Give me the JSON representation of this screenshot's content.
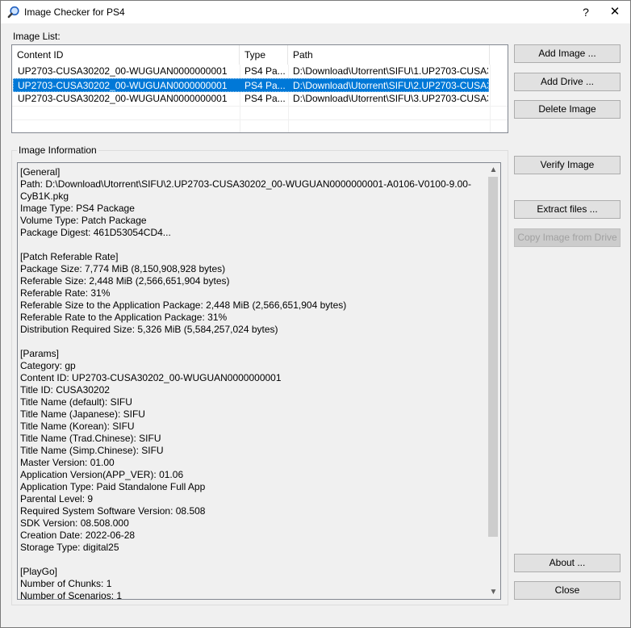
{
  "window": {
    "title": "Image Checker for PS4",
    "help_label": "?",
    "close_label": "✕"
  },
  "image_list": {
    "label": "Image List:",
    "columns": [
      "Content ID",
      "Type",
      "Path"
    ],
    "rows": [
      {
        "content_id": "UP2703-CUSA30202_00-WUGUAN0000000001",
        "type": "PS4 Pa...",
        "path": "D:\\Download\\Utorrent\\SIFU\\1.UP2703-CUSA3...",
        "selected": false
      },
      {
        "content_id": "UP2703-CUSA30202_00-WUGUAN0000000001",
        "type": "PS4 Pa...",
        "path": "D:\\Download\\Utorrent\\SIFU\\2.UP2703-CUSA3...",
        "selected": true
      },
      {
        "content_id": "UP2703-CUSA30202_00-WUGUAN0000000001",
        "type": "PS4 Pa...",
        "path": "D:\\Download\\Utorrent\\SIFU\\3.UP2703-CUSA3...",
        "selected": false
      }
    ]
  },
  "buttons": {
    "add_image": "Add Image ...",
    "add_drive": "Add Drive ...",
    "delete_image": "Delete Image",
    "verify_image": "Verify Image",
    "extract_files": "Extract files ...",
    "copy_image": "Copy Image from Drive",
    "about": "About ...",
    "close": "Close"
  },
  "image_info": {
    "label": "Image Information",
    "text": "[General]\nPath: D:\\Download\\Utorrent\\SIFU\\2.UP2703-CUSA30202_00-WUGUAN0000000001-A0106-V0100-9.00-CyB1K.pkg\nImage Type: PS4 Package\nVolume Type: Patch Package\nPackage Digest: 461D53054CD4...\n\n[Patch Referable Rate]\nPackage Size: 7,774 MiB (8,150,908,928 bytes)\nReferable Size: 2,448 MiB (2,566,651,904 bytes)\nReferable Rate: 31%\nReferable Size to the Application Package: 2,448 MiB (2,566,651,904 bytes)\nReferable Rate to the Application Package: 31%\nDistribution Required Size: 5,326 MiB (5,584,257,024 bytes)\n\n[Params]\nCategory: gp\nContent ID: UP2703-CUSA30202_00-WUGUAN0000000001\nTitle ID: CUSA30202\nTitle Name (default): SIFU\nTitle Name (Japanese): SIFU\nTitle Name (Korean): SIFU\nTitle Name (Trad.Chinese): SIFU\nTitle Name (Simp.Chinese): SIFU\nMaster Version: 01.00\nApplication Version(APP_VER): 01.06\nApplication Type: Paid Standalone Full App\nParental Level: 9\nRequired System Software Version: 08.508\nSDK Version: 08.508.000\nCreation Date: 2022-06-28\nStorage Type: digital25\n\n[PlayGo]\nNumber of Chunks: 1\nNumber of Scenarios: 1"
  }
}
